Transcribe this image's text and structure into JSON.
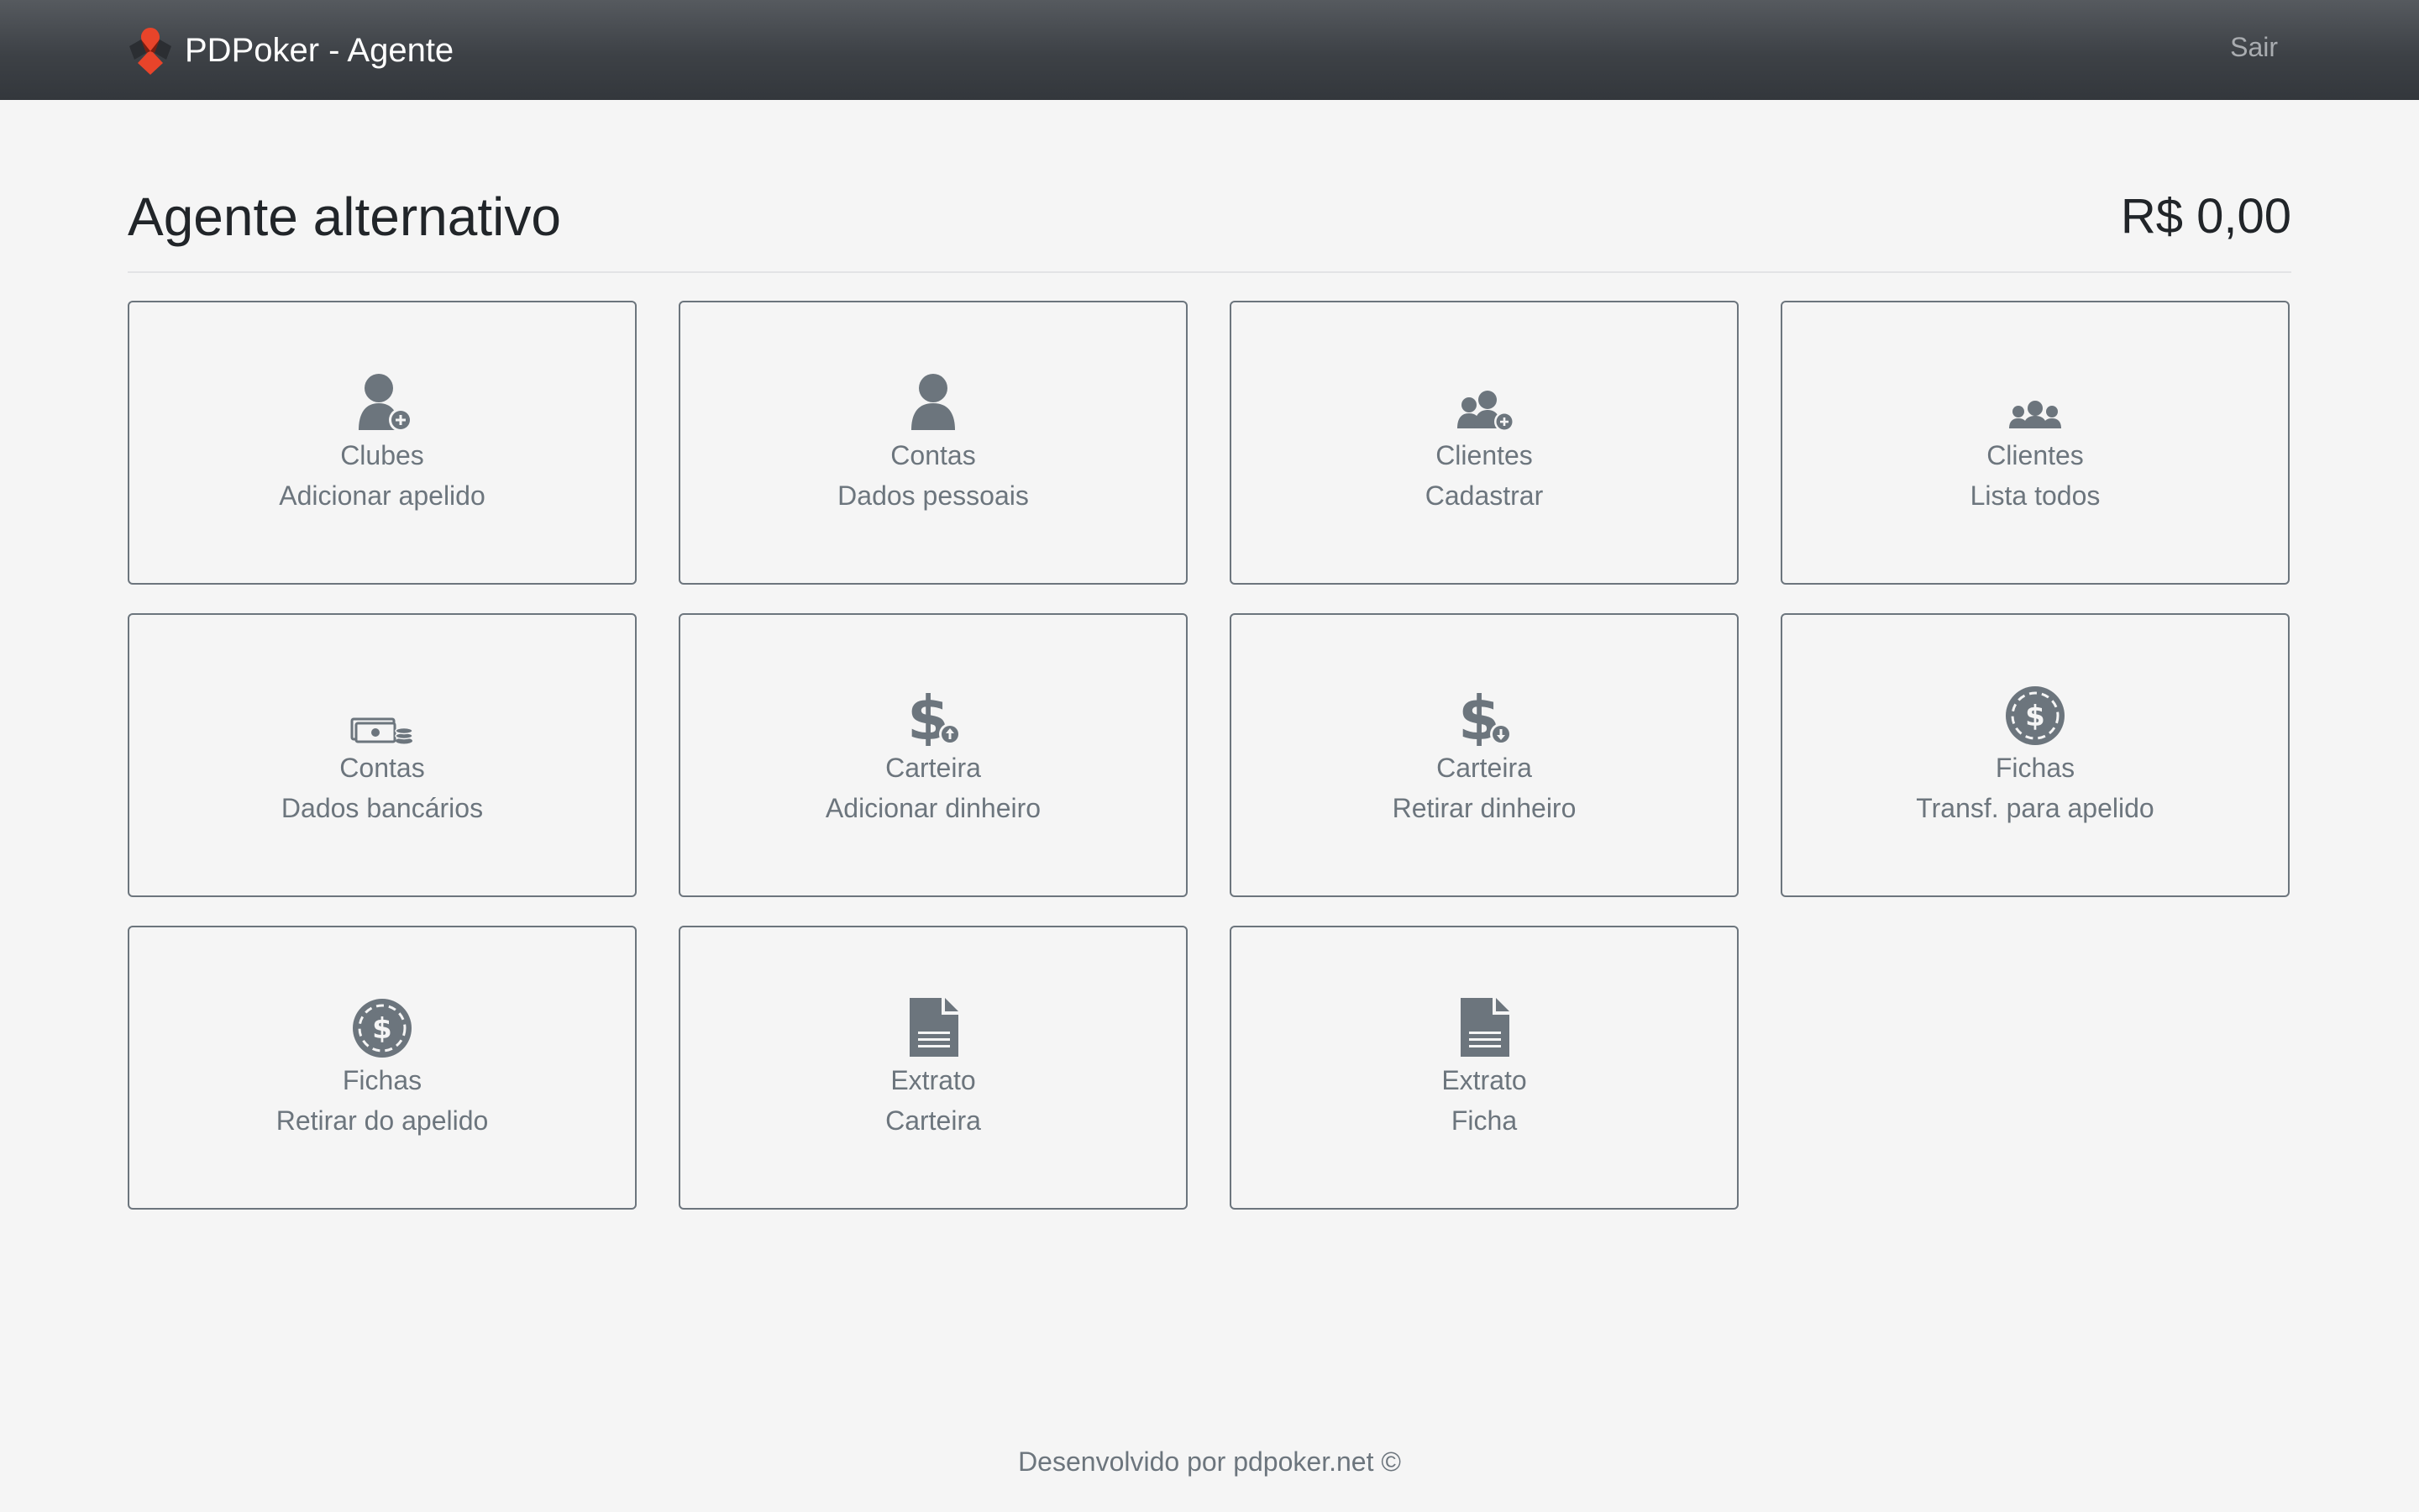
{
  "navbar": {
    "brand": "PDPoker - Agente",
    "logout_label": "Sair"
  },
  "header": {
    "title": "Agente alternativo",
    "balance": "R$ 0,00"
  },
  "cards": [
    {
      "icon": "user-plus-icon",
      "title": "Clubes",
      "subtitle": "Adicionar apelido"
    },
    {
      "icon": "user-icon",
      "title": "Contas",
      "subtitle": "Dados pessoais"
    },
    {
      "icon": "users-plus-icon",
      "title": "Clientes",
      "subtitle": "Cadastrar"
    },
    {
      "icon": "users-icon",
      "title": "Clientes",
      "subtitle": "Lista todos"
    },
    {
      "icon": "money-icon",
      "title": "Contas",
      "subtitle": "Dados bancários"
    },
    {
      "icon": "dollar-up-icon",
      "title": "Carteira",
      "subtitle": "Adicionar dinheiro"
    },
    {
      "icon": "dollar-down-icon",
      "title": "Carteira",
      "subtitle": "Retirar dinheiro"
    },
    {
      "icon": "poker-chip-icon",
      "title": "Fichas",
      "subtitle": "Transf. para apelido"
    },
    {
      "icon": "poker-chip-icon",
      "title": "Fichas",
      "subtitle": "Retirar do apelido"
    },
    {
      "icon": "document-icon",
      "title": "Extrato",
      "subtitle": "Carteira"
    },
    {
      "icon": "document-icon",
      "title": "Extrato",
      "subtitle": "Ficha"
    }
  ],
  "footer": {
    "text": "Desenvolvido por pdpoker.net ©"
  },
  "colors": {
    "navbar_top": "#565a5f",
    "navbar_bottom": "#33373c",
    "background": "#f5f5f5",
    "card_border": "#6c757d",
    "icon": "#6c757d",
    "logo_red": "#e8442a"
  }
}
